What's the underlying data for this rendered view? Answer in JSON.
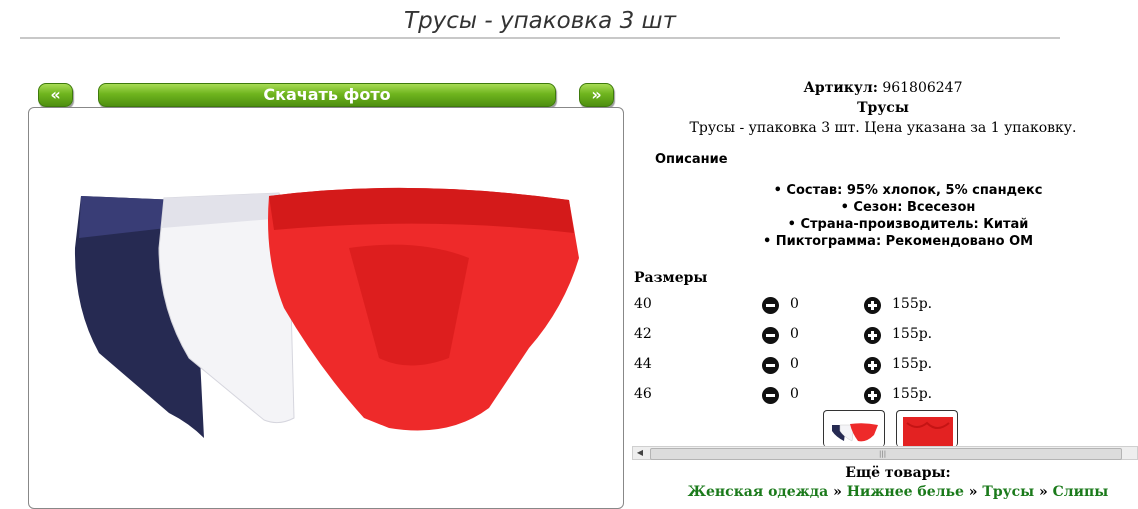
{
  "page": {
    "title": "Трусы - упаковка 3 шт"
  },
  "gallery": {
    "prev_label": "«",
    "download_label": "Скачать фото",
    "next_label": "»"
  },
  "product": {
    "article_label": "Артикул:",
    "article_value": "961806247",
    "name": "Трусы",
    "summary": "Трусы - упаковка 3 шт. Цена указана за 1 упаковку.",
    "description_heading": "Описание",
    "bullets": [
      "Состав: 95% хлопок, 5% спандекс",
      "Сезон: Всесезон",
      "Страна-производитель: Китай",
      "Пиктограмма: Рекомендовано ОМ"
    ],
    "colors": {
      "navy": "#262a52",
      "white": "#f4f4f7",
      "red": "#ee2a2a"
    }
  },
  "sizes": {
    "heading": "Размеры",
    "rows": [
      {
        "size": "40",
        "qty": "0",
        "price": "155р."
      },
      {
        "size": "42",
        "qty": "0",
        "price": "155р."
      },
      {
        "size": "44",
        "qty": "0",
        "price": "155р."
      },
      {
        "size": "46",
        "qty": "0",
        "price": "155р."
      }
    ]
  },
  "scrollbar": {
    "left_arrow": "◀",
    "grip": "|||"
  },
  "more": {
    "heading": "Ещё товары:",
    "crumbs": [
      "Женская одежда",
      "Нижнее белье",
      "Трусы",
      "Слипы"
    ],
    "separator": "»"
  },
  "accent": "#6fb51e"
}
